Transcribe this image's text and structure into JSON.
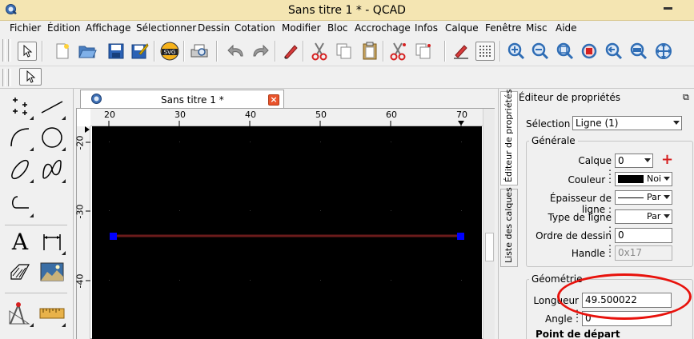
{
  "window": {
    "title": "Sans titre 1 * - QCAD"
  },
  "menu": [
    "Fichier",
    "Édition",
    "Affichage",
    "Sélectionner",
    "Dessin",
    "Cotation",
    "Modifier",
    "Bloc",
    "Accrochage",
    "Infos",
    "Calque",
    "Fenêtre",
    "Misc",
    "Aide"
  ],
  "toolbar": {
    "icons": [
      "select-arrow-icon",
      "new-document-icon",
      "open-folder-icon",
      "save-icon",
      "save-as-icon",
      "svg-export-icon",
      "print-preview-icon",
      "undo-icon",
      "redo-icon",
      "pen-icon",
      "cut-icon",
      "copy-icon",
      "paste-icon",
      "cut-reference-icon",
      "copy-reference-icon",
      "draft-pen-icon",
      "grid-icon",
      "zoom-in-icon",
      "zoom-out-icon",
      "zoom-auto-icon",
      "zoom-selection-icon",
      "zoom-previous-icon",
      "zoom-window-icon",
      "pan-icon"
    ],
    "svg_label": "SVG"
  },
  "document": {
    "tab_title": "Sans titre 1 *",
    "close_glyph": "×"
  },
  "rulers": {
    "h_ticks": [
      "20",
      "30",
      "40",
      "50",
      "60",
      "70"
    ],
    "v_ticks": [
      "-20",
      "-30",
      "-40"
    ]
  },
  "colors": {
    "line": "#6b1b1b",
    "handle": "#0000ff",
    "canvas": "#000000",
    "highlight": "#e8120c"
  },
  "tools": {
    "text_glyph": "A"
  },
  "properties": {
    "title": "Éditeur de propriétés",
    "float_glyph": "⧉",
    "tab_properties": "Éditeur de propriétés",
    "tab_layers": "Liste des calques",
    "selection_label": "Sélection :",
    "selection_value": "Ligne (1)",
    "general_title": "Générale",
    "layer_label": "Calque :",
    "layer_value": "0",
    "add_layer": "+",
    "color_label": "Couleur :",
    "color_value": "Noi",
    "lineweight_label": "Épaisseur de ligne :",
    "lineweight_value": "Par",
    "linetype_label": "Type de ligne :",
    "linetype_value": "Par",
    "draworder_label": "Ordre de dessin :",
    "draworder_value": "0",
    "handle_label": "Handle :",
    "handle_value": "0x17",
    "geometry_title": "Géométrie",
    "length_label": "Longueur :",
    "length_value": "49.500022",
    "angle_label": "Angle :",
    "angle_value": "0",
    "start_point": "Point de départ"
  }
}
